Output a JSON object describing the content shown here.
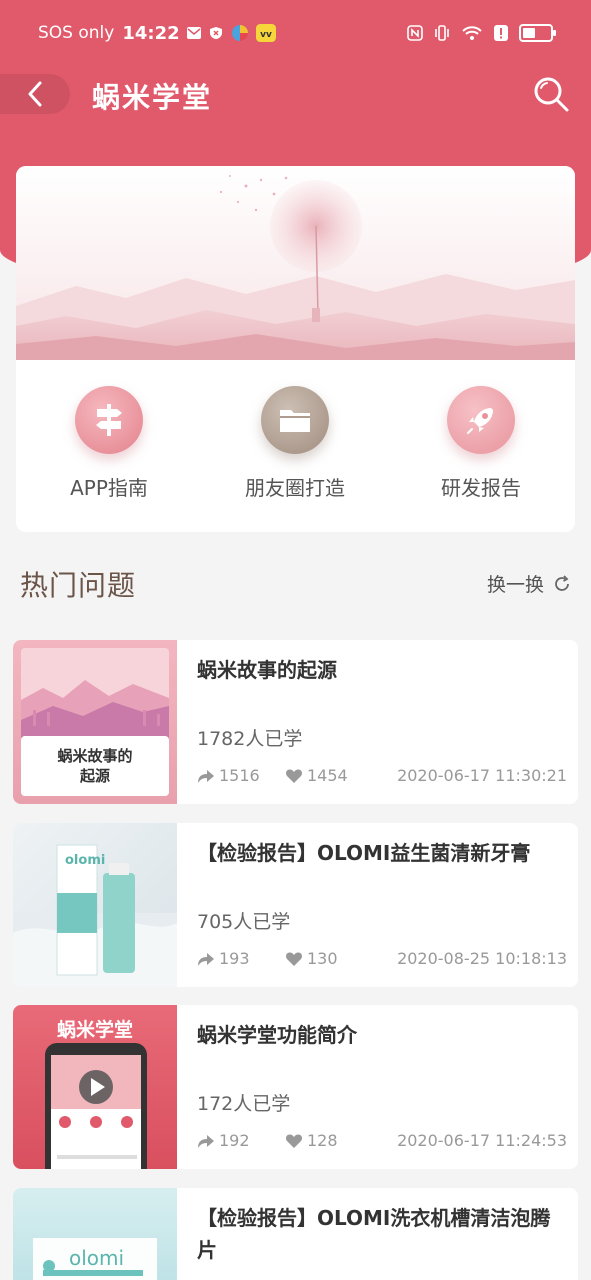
{
  "status_bar": {
    "carrier": "SOS only",
    "time": "14:22"
  },
  "header": {
    "title": "蜗米学堂"
  },
  "shortcuts": [
    {
      "label": "APP指南",
      "icon": "signpost-icon"
    },
    {
      "label": "朋友圈打造",
      "icon": "folder-icon"
    },
    {
      "label": "研发报告",
      "icon": "rocket-icon"
    }
  ],
  "section": {
    "title": "热门问题",
    "refresh_label": "换一换"
  },
  "articles": [
    {
      "title": "蜗米故事的起源",
      "learners": "1782人已学",
      "shares": "1516",
      "likes": "1454",
      "date": "2020-06-17 11:30:21",
      "thumb_caption_line1": "蜗米故事的",
      "thumb_caption_line2": "起源"
    },
    {
      "title": "【检验报告】OLOMI益生菌清新牙膏",
      "learners": "705人已学",
      "shares": "193",
      "likes": "130",
      "date": "2020-08-25 10:18:13",
      "thumb_brand": "olomi"
    },
    {
      "title": "蜗米学堂功能简介",
      "learners": "172人已学",
      "shares": "192",
      "likes": "128",
      "date": "2020-06-17 11:24:53",
      "thumb_label": "蜗米学堂"
    },
    {
      "title": "【检验报告】OLOMI洗衣机槽清洁泡腾片",
      "thumb_brand": "olomi"
    }
  ],
  "colors": {
    "brand": "#e05a6b",
    "background": "#f4f4f4"
  }
}
